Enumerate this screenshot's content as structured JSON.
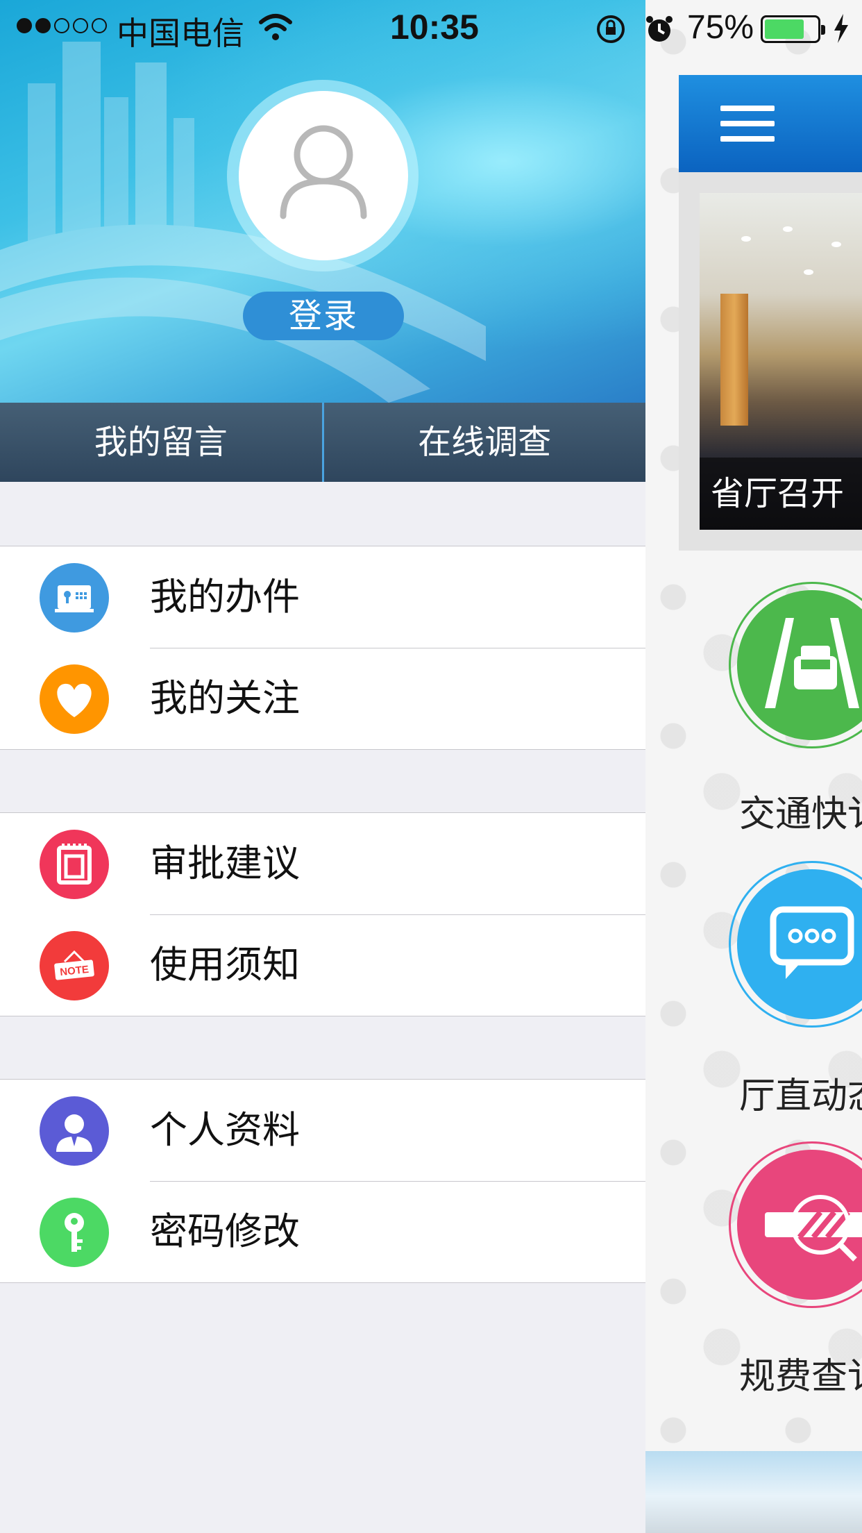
{
  "status_bar": {
    "carrier": "中国电信",
    "time": "10:35",
    "battery_percent": "75%",
    "battery_level": 0.75,
    "signal_bars_filled": 2,
    "signal_bars_total": 5
  },
  "drawer": {
    "login_label": "登录",
    "tabs": [
      {
        "label": "我的留言"
      },
      {
        "label": "在线调查"
      }
    ],
    "groups": [
      {
        "items": [
          {
            "label": "我的办件",
            "icon": "id-card-icon",
            "color": "#3f9ae0"
          },
          {
            "label": "我的关注",
            "icon": "heart-icon",
            "color": "#ff9500"
          }
        ]
      },
      {
        "items": [
          {
            "label": "审批建议",
            "icon": "document-icon",
            "color": "#f0365a"
          },
          {
            "label": "使用须知",
            "icon": "note-sign-icon",
            "color": "#f23b3b"
          }
        ]
      },
      {
        "items": [
          {
            "label": "个人资料",
            "icon": "person-icon",
            "color": "#5b5bd6"
          },
          {
            "label": "密码修改",
            "icon": "key-icon",
            "color": "#4cd964"
          }
        ]
      }
    ],
    "note_text": "NOTE"
  },
  "main": {
    "banner_caption": "省厅召开",
    "tiles": [
      {
        "label": "交通快讠",
        "icon": "car-road-icon",
        "color": "#4cb84c"
      },
      {
        "label": "厅直动态",
        "icon": "message-bubble-icon",
        "color": "#2fb0f0"
      },
      {
        "label": "规费查讠",
        "icon": "no-fee-icon",
        "color": "#e8467c"
      }
    ]
  }
}
